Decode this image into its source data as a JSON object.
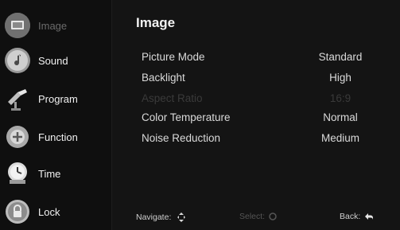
{
  "sidebar": {
    "items": [
      {
        "label": "Image",
        "icon": "image-icon",
        "active": true
      },
      {
        "label": "Sound",
        "icon": "sound-icon",
        "active": false
      },
      {
        "label": "Program",
        "icon": "program-icon",
        "active": false
      },
      {
        "label": "Function",
        "icon": "function-icon",
        "active": false
      },
      {
        "label": "Time",
        "icon": "time-icon",
        "active": false
      },
      {
        "label": "Lock",
        "icon": "lock-icon",
        "active": false
      }
    ]
  },
  "main": {
    "title": "Image",
    "settings": [
      {
        "label": "Picture Mode",
        "value": "Standard",
        "enabled": true
      },
      {
        "label": "Backlight",
        "value": "High",
        "enabled": true
      },
      {
        "label": "Aspect Ratio",
        "value": "16:9",
        "enabled": false
      },
      {
        "label": "Color Temperature",
        "value": "Normal",
        "enabled": true
      },
      {
        "label": "Noise Reduction",
        "value": "Medium",
        "enabled": true
      }
    ]
  },
  "footer": {
    "navigate": "Navigate:",
    "select": "Select:",
    "back": "Back:"
  },
  "colors": {
    "background": "#141414",
    "sidebar": "#0f0f0f",
    "active_icon": "#6a6a6a"
  }
}
